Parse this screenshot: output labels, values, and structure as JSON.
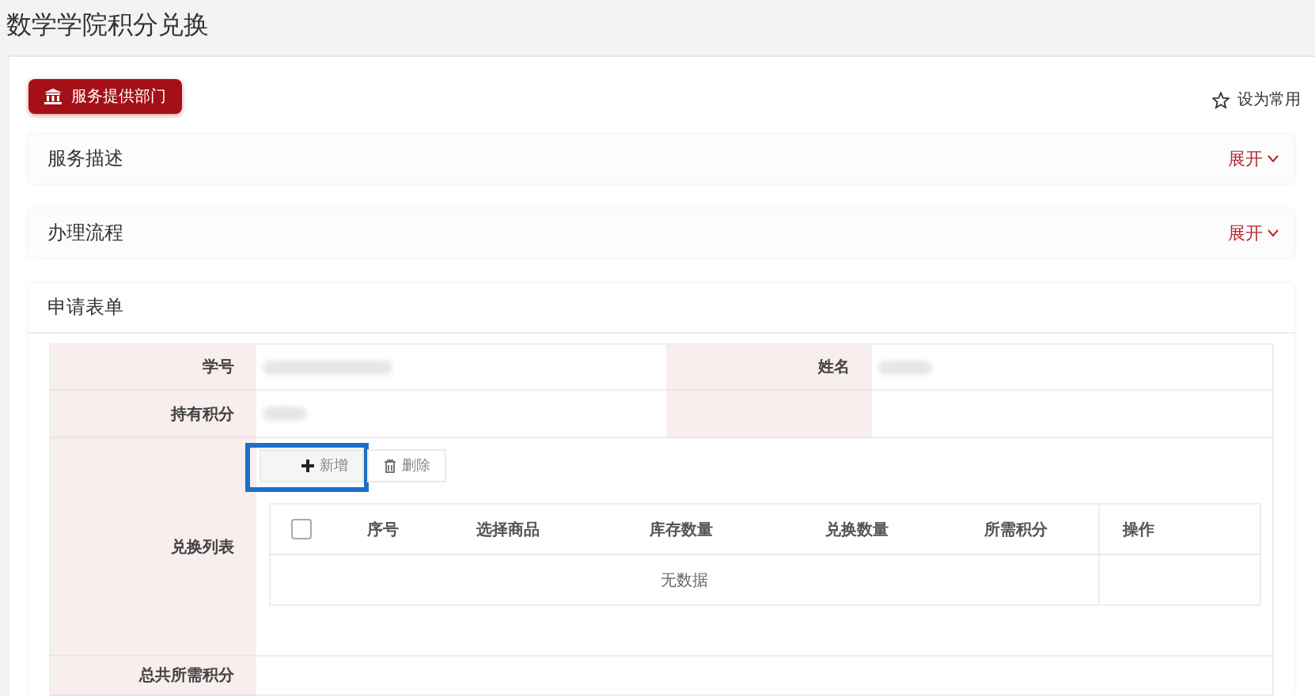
{
  "page_title": "数学学院积分兑换",
  "department_button": {
    "label": "服务提供部门"
  },
  "favorite": {
    "label": "设为常用",
    "on": false
  },
  "sections": [
    {
      "title": "服务描述",
      "toggle": "展开",
      "expanded": false
    },
    {
      "title": "办理流程",
      "toggle": "展开",
      "expanded": false
    }
  ],
  "form": {
    "title": "申请表单",
    "rows": [
      {
        "kind": "pair",
        "label": "学号",
        "value_blurred": true,
        "label_2": "姓名",
        "value_2_blurred": true
      },
      {
        "kind": "pair",
        "label": "持有积分",
        "value_blurred": true,
        "value_2_blurred": false
      },
      {
        "kind": "list",
        "label": "兑换列表",
        "toolbar": [
          {
            "kind": "add",
            "label": "新增",
            "highlighted": true
          },
          {
            "kind": "delete",
            "label": "删除",
            "highlighted": false
          }
        ],
        "table": {
          "select_all_checked": false,
          "columns": [
            "序号",
            "选择商品",
            "库存数量",
            "兑换数量",
            "所需积分",
            "操作"
          ],
          "empty_text": "无数据"
        }
      },
      {
        "kind": "wide",
        "label": "总共所需积分",
        "value_blurred": false
      }
    ]
  }
}
